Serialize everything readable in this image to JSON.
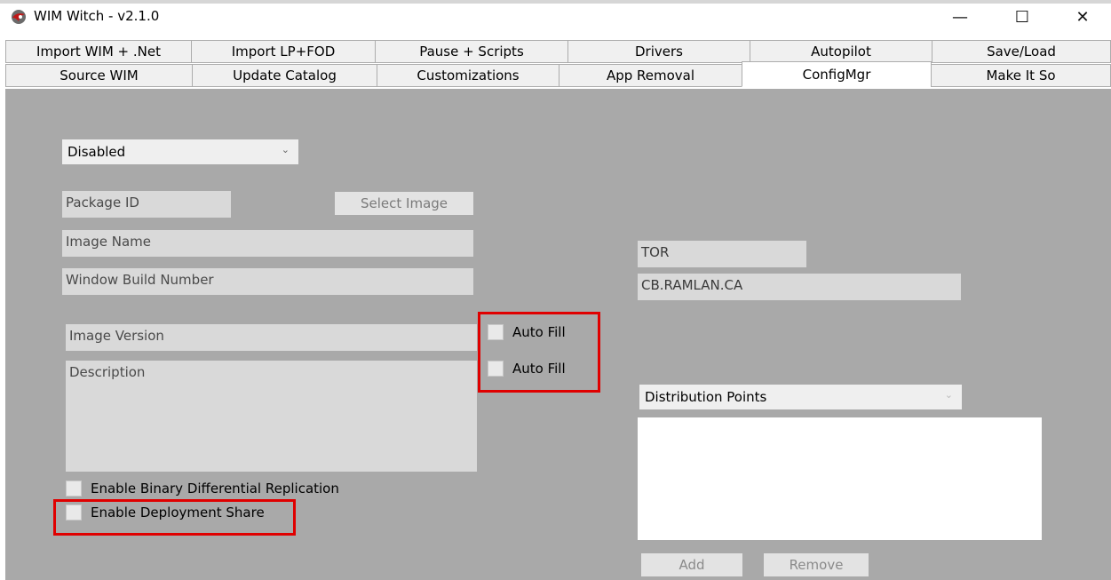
{
  "window": {
    "title": "WIM Witch - v2.1.0",
    "controls": {
      "minimize": "—",
      "maximize": "☐",
      "close": "✕"
    }
  },
  "tabs": {
    "row1": [
      "Import WIM + .Net",
      "Import LP+FOD",
      "Pause + Scripts",
      "Drivers",
      "Autopilot",
      "Save/Load"
    ],
    "row2": [
      "Source WIM",
      "Update Catalog",
      "Customizations",
      "App Removal",
      "ConfigMgr",
      "Make It So"
    ],
    "selected": "ConfigMgr"
  },
  "configmgr": {
    "mode_select": {
      "value": "Disabled"
    },
    "package_id": {
      "placeholder": "Package ID"
    },
    "select_image_label": "Select Image",
    "image_name": {
      "placeholder": "Image Name"
    },
    "build_number": {
      "placeholder": "Window Build Number"
    },
    "image_version": {
      "placeholder": "Image Version"
    },
    "description": {
      "placeholder": "Description"
    },
    "auto_fill_version": "Auto Fill",
    "auto_fill_description": "Auto Fill",
    "binary_diff_replication": "Enable Binary Differential Replication",
    "deployment_share": "Enable Deployment Share",
    "site_code": "TOR",
    "site_server": "CB.RAMLAN.CA",
    "distribution_select": {
      "value": "Distribution Points"
    },
    "add_label": "Add",
    "remove_label": "Remove"
  },
  "colors": {
    "content_bg": "#a9a9a9",
    "highlight": "#e00000",
    "tab_bg": "#f0f0f0",
    "field_bg": "#d9d9d9"
  }
}
